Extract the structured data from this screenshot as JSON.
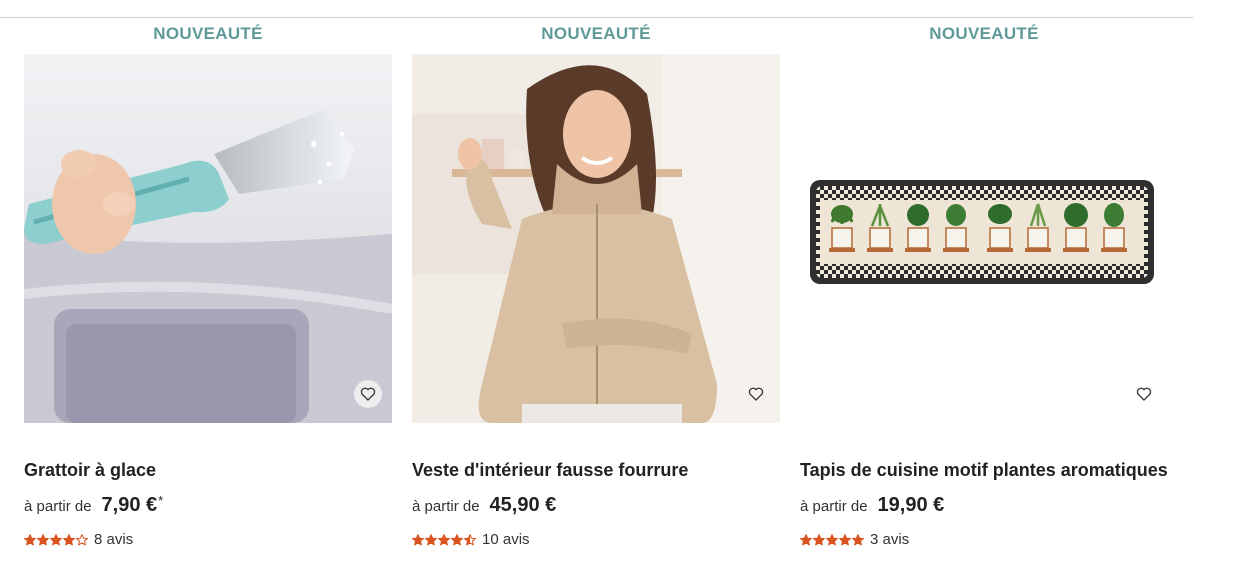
{
  "products": [
    {
      "badge": "NOUVEAUTÉ",
      "title": "Grattoir à glace",
      "price_prefix": "à partir de",
      "price": "7,90 €",
      "price_note": "*",
      "rating": 4,
      "reviews": "8 avis",
      "image": "ice-scraper-photo"
    },
    {
      "badge": "NOUVEAUTÉ",
      "title": "Veste d'intérieur fausse fourrure",
      "price_prefix": "à partir de",
      "price": "45,90 €",
      "price_note": "",
      "rating": 4.5,
      "reviews": "10 avis",
      "image": "fleece-jacket-photo"
    },
    {
      "badge": "NOUVEAUTÉ",
      "title": "Tapis de cuisine motif plantes aromatiques",
      "price_prefix": "à partir de",
      "price": "19,90 €",
      "price_note": "",
      "rating": 5,
      "reviews": "3 avis",
      "image": "herb-kitchen-rug-photo"
    }
  ],
  "colors": {
    "badge": "#5f9a98",
    "star": "#d9541f",
    "text": "#222222"
  }
}
